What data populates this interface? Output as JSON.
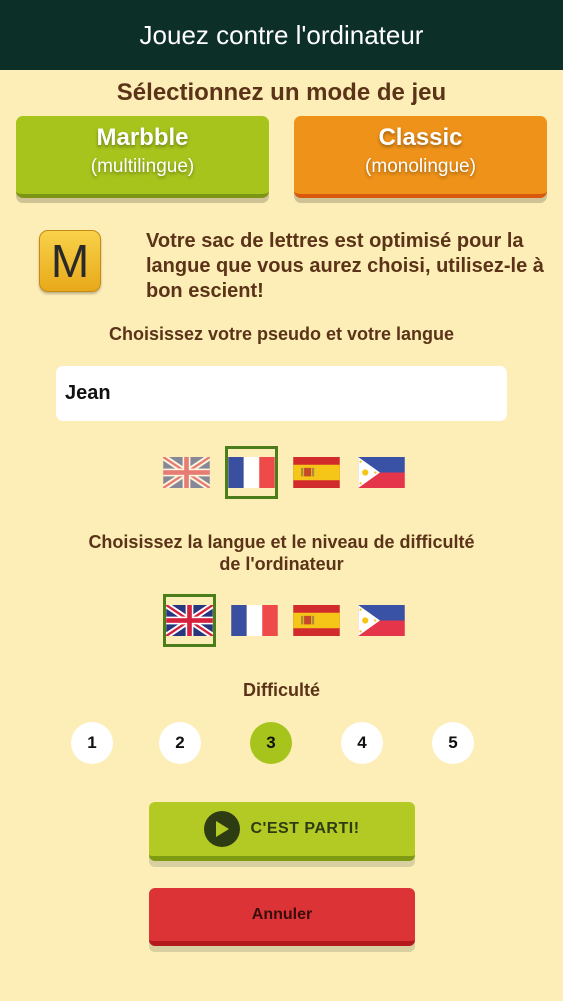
{
  "header": {
    "title": "Jouez contre l'ordinateur"
  },
  "mode_section": {
    "title": "Sélectionnez un mode de jeu"
  },
  "modes": [
    {
      "name": "Marbble",
      "subtitle": "(multilingue)",
      "color": "#a6c41c"
    },
    {
      "name": "Classic",
      "subtitle": "(monolingue)",
      "color": "#ef9219"
    }
  ],
  "info": {
    "tile_letter": "M",
    "text": "Votre sac de lettres est optimisé pour la langue que vous aurez choisi, utilisez-le à bon escient!"
  },
  "player": {
    "label": "Choisissez votre pseudo et votre langue",
    "pseudo": "Jean",
    "selected_language": "fr",
    "languages": [
      "en",
      "fr",
      "es",
      "ph"
    ]
  },
  "computer": {
    "label": "Choisissez la langue et le niveau de difficulté de l'ordinateur",
    "selected_language": "en",
    "languages": [
      "en",
      "fr",
      "es",
      "ph"
    ]
  },
  "difficulty": {
    "label": "Difficulté",
    "levels": [
      "1",
      "2",
      "3",
      "4",
      "5"
    ],
    "selected": "3"
  },
  "actions": {
    "start_label": "C'EST PARTI!",
    "cancel_label": "Annuler"
  },
  "colors": {
    "background": "#fdedb6",
    "header": "#0c2f28",
    "accent_green": "#a6c41c",
    "accent_orange": "#ef9219",
    "cancel_red": "#dc3436",
    "text_brown": "#5a3318"
  }
}
